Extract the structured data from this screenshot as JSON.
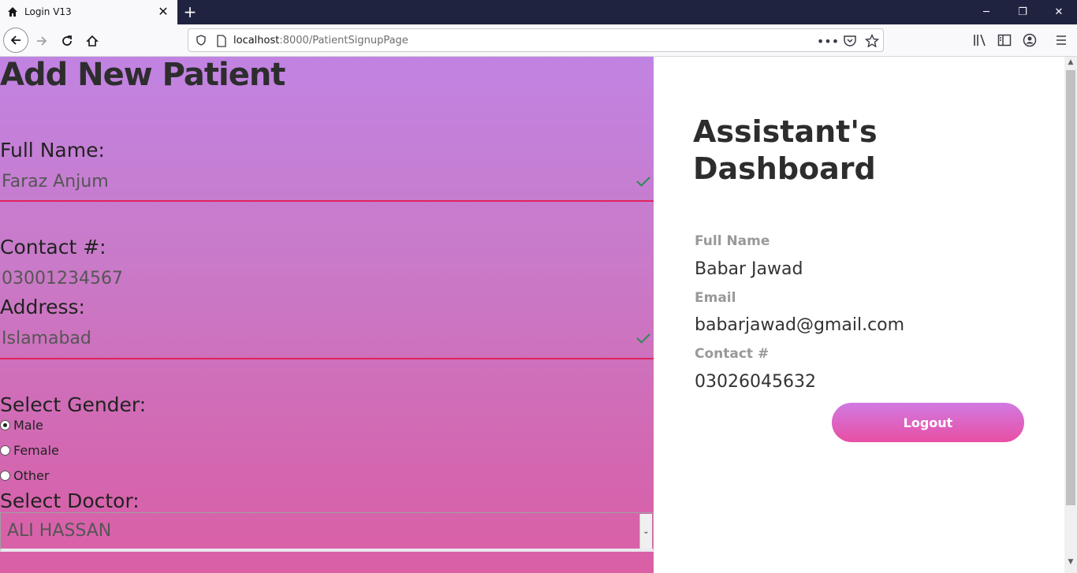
{
  "browser": {
    "tab_title": "Login V13",
    "tab_close": "✕",
    "new_tab": "+",
    "url_host": "localhost",
    "url_path": ":8000/PatientSignupPage",
    "window_controls": {
      "minimize": "─",
      "restore": "❐",
      "close": "✕"
    },
    "icons": [
      "home-icon",
      "back-arrow-icon",
      "forward-arrow-icon",
      "reload-icon",
      "home-icon",
      "shield-icon",
      "page-icon",
      "more-icon",
      "pocket-icon",
      "star-icon",
      "library-icon",
      "sidebar-icon",
      "account-icon",
      "menu-icon"
    ]
  },
  "form": {
    "title": "Add New Patient",
    "full_name_label": "Full Name:",
    "full_name_value": "Faraz Anjum",
    "contact_label": "Contact #:",
    "contact_value": "03001234567",
    "address_label": "Address:",
    "address_value": "Islamabad",
    "gender_label": "Select Gender:",
    "gender_options": [
      {
        "label": "Male",
        "checked": true
      },
      {
        "label": "Female",
        "checked": false
      },
      {
        "label": "Other",
        "checked": false
      }
    ],
    "doctor_label": "Select Doctor:",
    "doctor_selected": "ALI HASSAN"
  },
  "dashboard": {
    "title": "Assistant's Dashboard",
    "full_name_label": "Full Name",
    "full_name_value": "Babar Jawad",
    "email_label": "Email",
    "email_value": "babarjawad@gmail.com",
    "contact_label": "Contact #",
    "contact_value": "03026045632",
    "logout_label": "Logout"
  },
  "colors": {
    "accent_underline": "#e0245e",
    "valid_check": "#2e8b57",
    "gradient_top": "#c183e2",
    "gradient_bottom": "#da5fa5"
  }
}
